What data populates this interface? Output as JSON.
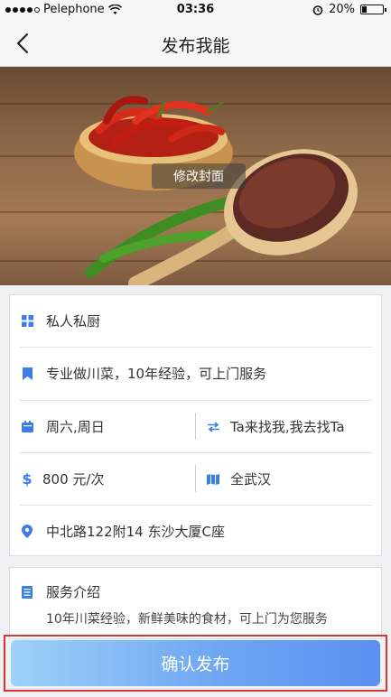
{
  "status_bar": {
    "carrier": "Pelephone",
    "time": "03:36",
    "battery": "20%"
  },
  "nav": {
    "title": "发布我能"
  },
  "cover": {
    "change_cover_label": "修改封面"
  },
  "form": {
    "category": "私人私厨",
    "description": "专业做川菜，10年经验，可上门服务",
    "days": "周六,周日",
    "meeting_mode": "Ta来找我,我去找Ta",
    "price": "800 元/次",
    "range": "全武汉",
    "address": "中北路122附14 东沙大厦C座"
  },
  "intro": {
    "title": "服务介绍",
    "text": "10年川菜经验，新鲜美味的食材，可上门为您服务"
  },
  "confirm": {
    "label": "确认发布"
  },
  "colors": {
    "accent": "#3a7ee6",
    "button_start": "#9ed1f8",
    "button_end": "#5b8ff0",
    "highlight_border": "#dd3333"
  },
  "icons": {
    "category": "grid-icon",
    "description": "bookmark-icon",
    "days": "calendar-icon",
    "meeting_mode": "swap-arrows-icon",
    "price": "dollar-icon",
    "range": "map-icon",
    "address": "location-pin-icon",
    "intro": "document-icon"
  }
}
